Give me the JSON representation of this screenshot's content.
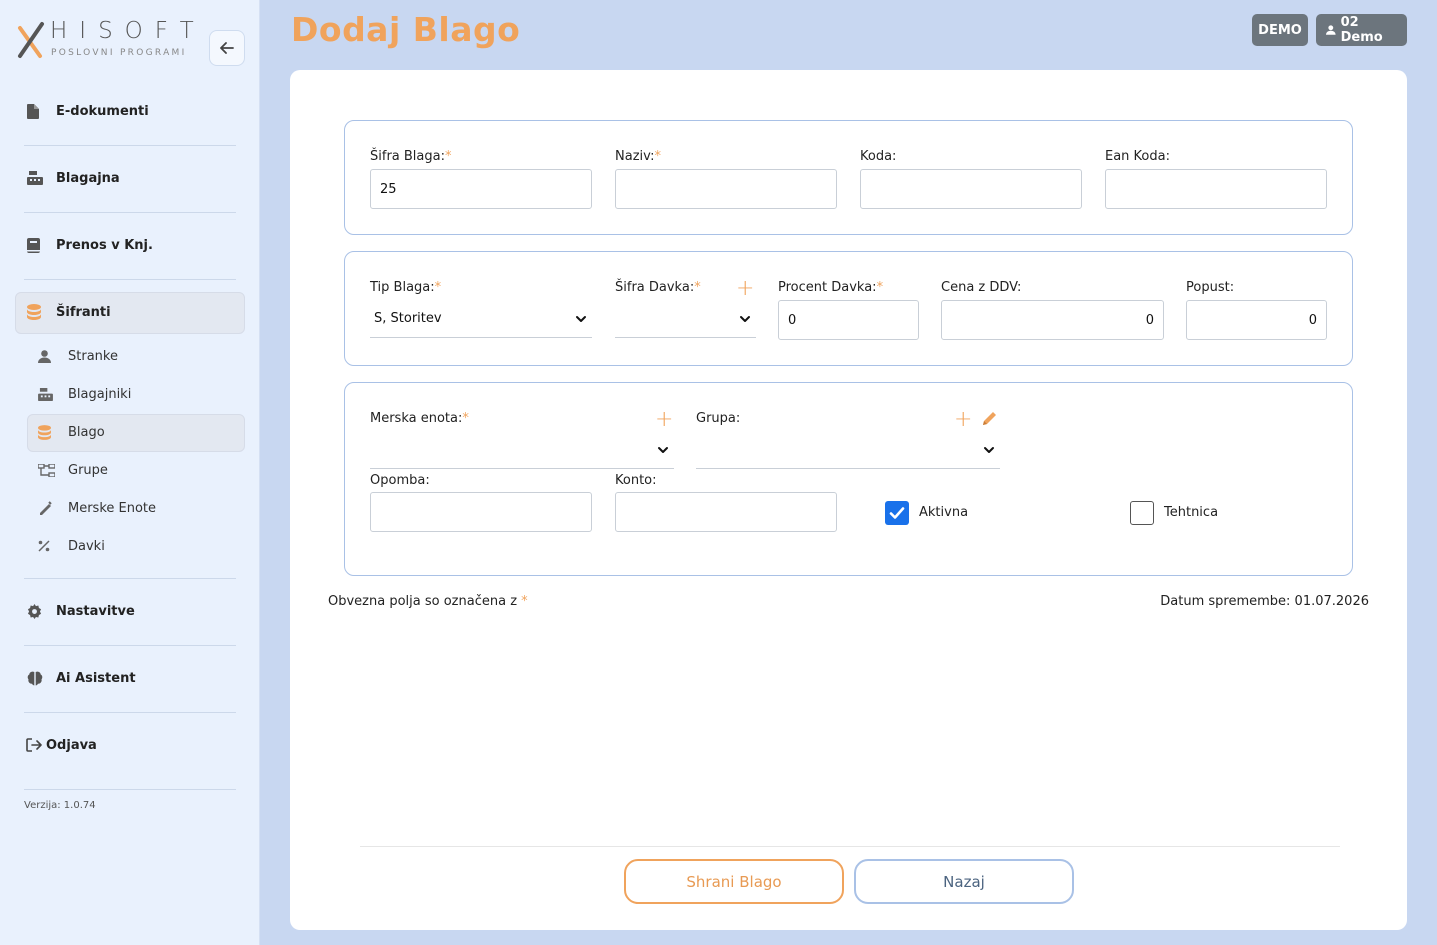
{
  "brand": {
    "name": "HISOFT",
    "tagline": "POSLOVNI PROGRAMI"
  },
  "sidebar": {
    "main_items": [
      {
        "label": "E-dokumenti",
        "icon": "file-icon"
      },
      {
        "label": "Blagajna",
        "icon": "cash-register-icon"
      },
      {
        "label": "Prenos v Knj.",
        "icon": "book-icon"
      },
      {
        "label": "Šifranti",
        "icon": "database-icon"
      },
      {
        "label": "Nastavitve",
        "icon": "gear-icon"
      },
      {
        "label": "Ai Asistent",
        "icon": "brain-icon"
      },
      {
        "label": "Odjava",
        "icon": "logout-icon"
      }
    ],
    "sub_items": [
      {
        "label": "Stranke",
        "icon": "user-icon"
      },
      {
        "label": "Blagajniki",
        "icon": "cash-register-icon"
      },
      {
        "label": "Blago",
        "icon": "database-icon"
      },
      {
        "label": "Grupe",
        "icon": "sitemap-icon"
      },
      {
        "label": "Merske Enote",
        "icon": "ruler-icon"
      },
      {
        "label": "Davki",
        "icon": "percent-icon"
      }
    ],
    "version": "Verzija: 1.0.74"
  },
  "header": {
    "title": "Dodaj Blago",
    "env_badge": "DEMO",
    "user_badge": "02 Demo"
  },
  "form": {
    "required_mark": "*",
    "sifra_label": "Šifra Blaga:",
    "sifra_value": "25",
    "naziv_label": "Naziv:",
    "naziv_value": "",
    "koda_label": "Koda:",
    "koda_value": "",
    "ean_label": "Ean Koda:",
    "ean_value": "",
    "tip_label": "Tip Blaga:",
    "tip_value": "S, Storitev",
    "sifra_davka_label": "Šifra Davka:",
    "sifra_davka_value": "",
    "procent_label": "Procent Davka:",
    "procent_value": "0",
    "cena_label": "Cena z DDV:",
    "cena_value": "0",
    "popust_label": "Popust:",
    "popust_value": "0",
    "merska_label": "Merska enota:",
    "merska_value": "",
    "grupa_label": "Grupa:",
    "grupa_value": "",
    "opomba_label": "Opomba:",
    "opomba_value": "",
    "konto_label": "Konto:",
    "konto_value": "",
    "aktivna_label": "Aktivna",
    "aktivna_checked": true,
    "tehtnica_label": "Tehtnica",
    "tehtnica_checked": false,
    "required_note": "Obvezna polja so označena z",
    "date_note": "Datum spremembe: 01.07.2026"
  },
  "actions": {
    "save_label": "Shrani Blago",
    "back_label": "Nazaj"
  },
  "colors": {
    "accent": "#f0a35c",
    "checkbox": "#1971ea",
    "border": "#a9c1e6"
  }
}
